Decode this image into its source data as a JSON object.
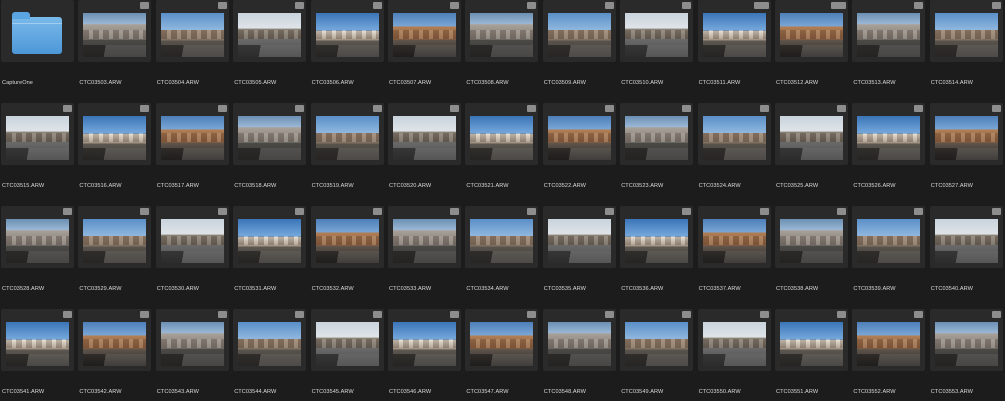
{
  "browser": {
    "items": [
      {
        "name": "CaptureOne",
        "type": "folder"
      },
      {
        "name": "CTC03503.ARW",
        "type": "image"
      },
      {
        "name": "CTC03504.ARW",
        "type": "image"
      },
      {
        "name": "CTC03505.ARW",
        "type": "image"
      },
      {
        "name": "CTC03506.ARW",
        "type": "image"
      },
      {
        "name": "CTC03507.ARW",
        "type": "image"
      },
      {
        "name": "CTC03508.ARW",
        "type": "image"
      },
      {
        "name": "CTC03509.ARW",
        "type": "image"
      },
      {
        "name": "CTC03510.ARW",
        "type": "image"
      },
      {
        "name": "CTC03511.ARW",
        "type": "image"
      },
      {
        "name": "CTC03512.ARW",
        "type": "image"
      },
      {
        "name": "CTC03513.ARW",
        "type": "image"
      },
      {
        "name": "CTC03514.ARW",
        "type": "image"
      },
      {
        "name": "CTC03515.ARW",
        "type": "image"
      },
      {
        "name": "CTC03516.ARW",
        "type": "image"
      },
      {
        "name": "CTC03517.ARW",
        "type": "image"
      },
      {
        "name": "CTC03518.ARW",
        "type": "image"
      },
      {
        "name": "CTC03519.ARW",
        "type": "image"
      },
      {
        "name": "CTC03520.ARW",
        "type": "image"
      },
      {
        "name": "CTC03521.ARW",
        "type": "image"
      },
      {
        "name": "CTC03522.ARW",
        "type": "image"
      },
      {
        "name": "CTC03523.ARW",
        "type": "image"
      },
      {
        "name": "CTC03524.ARW",
        "type": "image"
      },
      {
        "name": "CTC03525.ARW",
        "type": "image"
      },
      {
        "name": "CTC03526.ARW",
        "type": "image"
      },
      {
        "name": "CTC03527.ARW",
        "type": "image"
      },
      {
        "name": "CTC03528.ARW",
        "type": "image"
      },
      {
        "name": "CTC03529.ARW",
        "type": "image"
      },
      {
        "name": "CTC03530.ARW",
        "type": "image"
      },
      {
        "name": "CTC03531.ARW",
        "type": "image"
      },
      {
        "name": "CTC03532.ARW",
        "type": "image"
      },
      {
        "name": "CTC03533.ARW",
        "type": "image"
      },
      {
        "name": "CTC03534.ARW",
        "type": "image"
      },
      {
        "name": "CTC03535.ARW",
        "type": "image"
      },
      {
        "name": "CTC03536.ARW",
        "type": "image"
      },
      {
        "name": "CTC03537.ARW",
        "type": "image"
      },
      {
        "name": "CTC03538.ARW",
        "type": "image"
      },
      {
        "name": "CTC03539.ARW",
        "type": "image"
      },
      {
        "name": "CTC03540.ARW",
        "type": "image"
      },
      {
        "name": "CTC03541.ARW",
        "type": "image"
      },
      {
        "name": "CTC03542.ARW",
        "type": "image"
      },
      {
        "name": "CTC03543.ARW",
        "type": "image"
      },
      {
        "name": "CTC03544.ARW",
        "type": "image"
      },
      {
        "name": "CTC03545.ARW",
        "type": "image"
      },
      {
        "name": "CTC03546.ARW",
        "type": "image"
      },
      {
        "name": "CTC03547.ARW",
        "type": "image"
      },
      {
        "name": "CTC03548.ARW",
        "type": "image"
      },
      {
        "name": "CTC03549.ARW",
        "type": "image"
      },
      {
        "name": "CTC03550.ARW",
        "type": "image"
      },
      {
        "name": "CTC03551.ARW",
        "type": "image"
      },
      {
        "name": "CTC03552.ARW",
        "type": "image"
      },
      {
        "name": "CTC03553.ARW",
        "type": "image"
      }
    ]
  }
}
